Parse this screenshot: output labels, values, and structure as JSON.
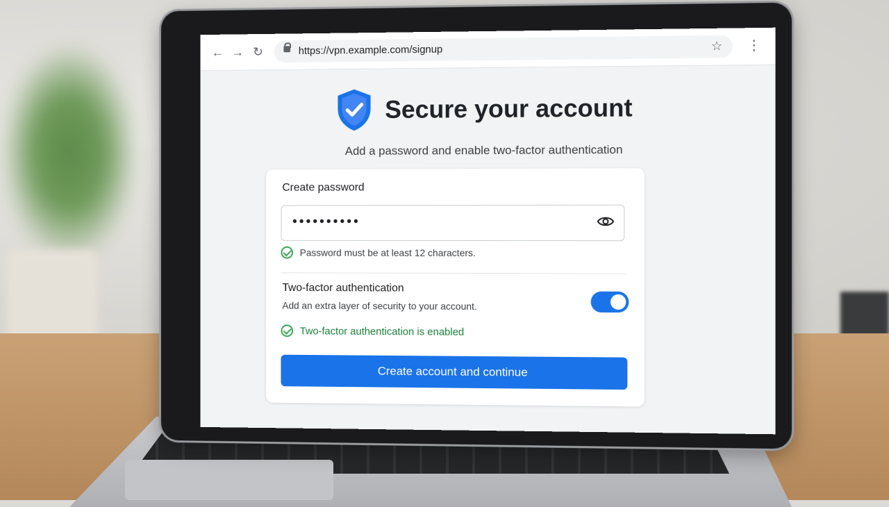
{
  "browser": {
    "url": "https://vpn.example.com/signup",
    "back_icon": "←",
    "forward_icon": "→",
    "reload_icon": "↻",
    "star_icon": "☆",
    "menu_icon": "⋮"
  },
  "page": {
    "title": "Secure your account",
    "subtitle": "Add a password and enable two-factor authentication"
  },
  "password": {
    "label": "Create password",
    "masked_value": "••••••••••",
    "hint": "Password must be at least 12 characters."
  },
  "two_factor": {
    "title": "Two-factor authentication",
    "description": "Add an extra layer of security to your account.",
    "enabled": true,
    "status_text": "Two-factor authentication is enabled"
  },
  "actions": {
    "submit_label": "Create account and continue"
  },
  "colors": {
    "accent": "#1a73e8",
    "success": "#188038"
  }
}
